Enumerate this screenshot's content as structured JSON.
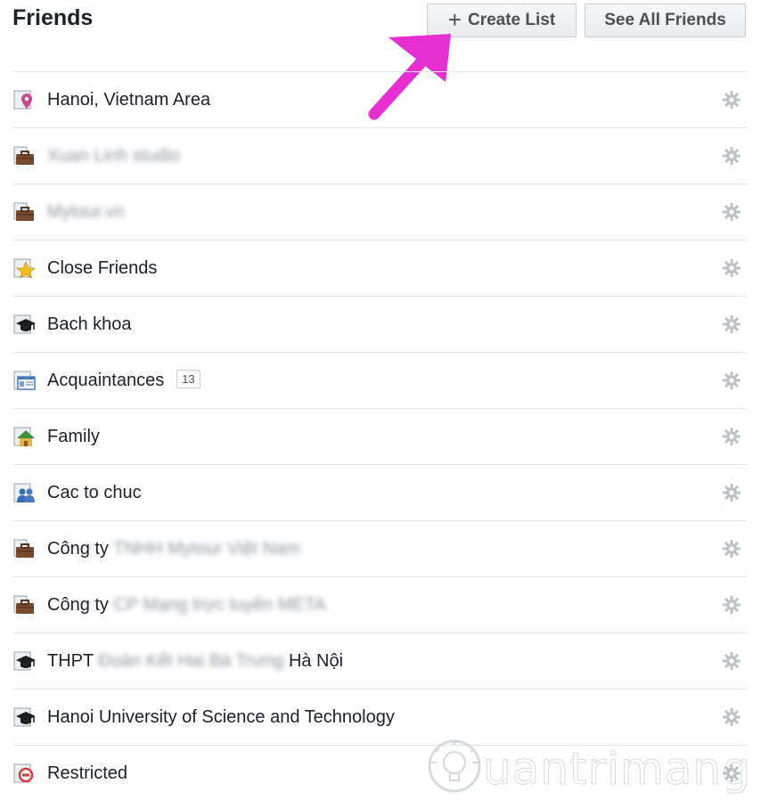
{
  "header": {
    "title": "Friends",
    "create_list_plus": "+",
    "create_list_label": "Create List",
    "see_all_label": "See All Friends"
  },
  "lists": [
    {
      "icon": "location-pin-icon",
      "label": "Hanoi, Vietnam Area",
      "blurred": ""
    },
    {
      "icon": "briefcase-icon",
      "label": "",
      "blurred": "Xuan Linh studio"
    },
    {
      "icon": "briefcase-icon",
      "label": "",
      "blurred": "Mytour.vn"
    },
    {
      "icon": "star-icon",
      "label": "Close Friends",
      "blurred": ""
    },
    {
      "icon": "graduation-cap-icon",
      "label": "Bach khoa",
      "blurred": ""
    },
    {
      "icon": "contact-card-icon",
      "label": "Acquaintances",
      "blurred": "",
      "count": "13"
    },
    {
      "icon": "house-icon",
      "label": "Family",
      "blurred": ""
    },
    {
      "icon": "people-icon",
      "label": "Cac to chuc",
      "blurred": ""
    },
    {
      "icon": "briefcase-icon",
      "label": "Công ty",
      "blurred": "TNHH Mytour Việt Nam"
    },
    {
      "icon": "briefcase-icon",
      "label": "Công ty",
      "blurred": "CP Mạng trực tuyến META"
    },
    {
      "icon": "graduation-cap-icon",
      "label": "THPT",
      "blurred": "Đoàn Kết Hai Bà Trưng",
      "suffix": "Hà Nội"
    },
    {
      "icon": "graduation-cap-icon",
      "label": "Hanoi University of Science and Technology",
      "blurred": ""
    },
    {
      "icon": "restricted-icon",
      "label": "Restricted",
      "blurred": ""
    }
  ],
  "colors": {
    "arrow": "#e52fd0",
    "border": "#e5e6e9",
    "button_text": "#4b4f56",
    "gear": "#bfc3c8"
  },
  "watermark": {
    "text": "uantrimang"
  }
}
